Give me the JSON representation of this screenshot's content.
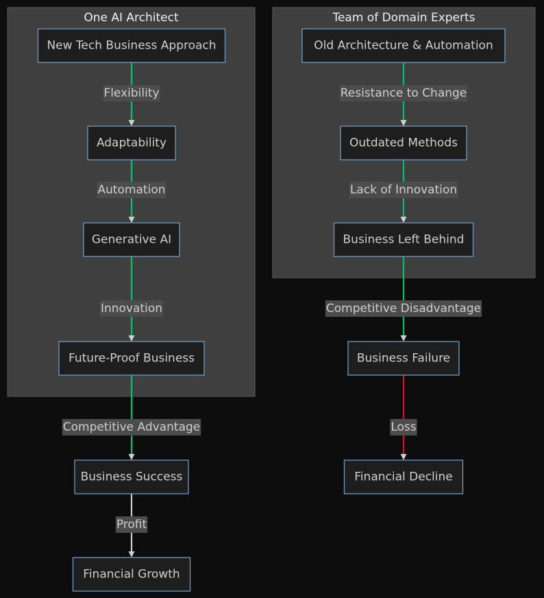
{
  "diagram": {
    "type": "flowchart",
    "direction": "top-down",
    "colors": {
      "background": "#0d0d0d",
      "cluster_fill": "#3e3f3e",
      "node_fill": "#1e1e1e",
      "node_border": "#6b9dc2",
      "text": "#cfcfcf",
      "edge_positive": "#00c26a",
      "edge_negative": "#e3101f",
      "edge_neutral": "#cfcfcf"
    },
    "clusters": [
      {
        "id": "ai",
        "title": "One AI Architect"
      },
      {
        "id": "team",
        "title": "Team of Domain Experts"
      }
    ],
    "nodes": [
      {
        "id": "n1",
        "label": "New Tech Business Approach",
        "cluster": "ai"
      },
      {
        "id": "n2",
        "label": "Adaptability",
        "cluster": "ai"
      },
      {
        "id": "n3",
        "label": "Generative AI",
        "cluster": "ai"
      },
      {
        "id": "n4",
        "label": "Future-Proof Business",
        "cluster": "ai"
      },
      {
        "id": "n5",
        "label": "Business Success",
        "cluster": null
      },
      {
        "id": "n6",
        "label": "Financial Growth",
        "cluster": null
      },
      {
        "id": "m1",
        "label": "Old Architecture & Automation",
        "cluster": "team"
      },
      {
        "id": "m2",
        "label": "Outdated Methods",
        "cluster": "team"
      },
      {
        "id": "m3",
        "label": "Business Left Behind",
        "cluster": "team"
      },
      {
        "id": "m4",
        "label": "Business Failure",
        "cluster": null
      },
      {
        "id": "m5",
        "label": "Financial Decline",
        "cluster": null
      }
    ],
    "edges": [
      {
        "from": "n1",
        "to": "n2",
        "label": "Flexibility",
        "color": "edge_positive"
      },
      {
        "from": "n2",
        "to": "n3",
        "label": "Automation",
        "color": "edge_positive"
      },
      {
        "from": "n3",
        "to": "n4",
        "label": "Innovation",
        "color": "edge_positive"
      },
      {
        "from": "n4",
        "to": "n5",
        "label": "Competitive Advantage",
        "color": "edge_positive"
      },
      {
        "from": "n5",
        "to": "n6",
        "label": "Profit",
        "color": "edge_neutral"
      },
      {
        "from": "m1",
        "to": "m2",
        "label": "Resistance to Change",
        "color": "edge_positive"
      },
      {
        "from": "m2",
        "to": "m3",
        "label": "Lack of Innovation",
        "color": "edge_positive"
      },
      {
        "from": "m3",
        "to": "m4",
        "label": "Competitive Disadvantage",
        "color": "edge_positive"
      },
      {
        "from": "m4",
        "to": "m5",
        "label": "Loss",
        "color": "edge_negative"
      }
    ]
  }
}
